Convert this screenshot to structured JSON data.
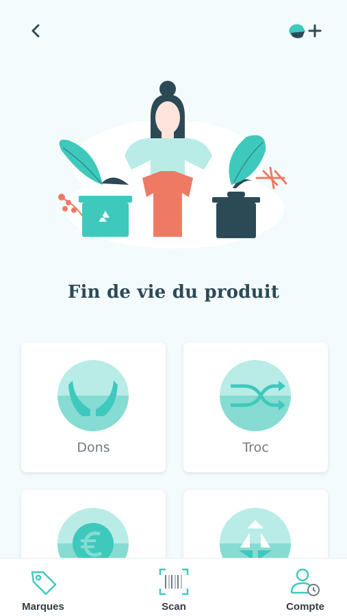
{
  "header": {
    "back_icon": "chevron-left-icon",
    "add_icon": "add-item-icon"
  },
  "page": {
    "title": "Fin de vie du produit"
  },
  "options": [
    {
      "label": "Dons",
      "icon": "hands-icon"
    },
    {
      "label": "Troc",
      "icon": "shuffle-icon"
    },
    {
      "label": "",
      "icon": "euro-icon"
    },
    {
      "label": "",
      "icon": "recycle-icon"
    }
  ],
  "bottom_nav": {
    "items": [
      {
        "label": "Marques",
        "icon": "tag-icon"
      },
      {
        "label": "Scan",
        "icon": "barcode-scan-icon"
      },
      {
        "label": "Compte",
        "icon": "user-clock-icon"
      }
    ]
  },
  "colors": {
    "background": "#f4fbfd",
    "accent_teal": "#3fc9bd",
    "accent_light": "#b9ece6",
    "coral": "#ef7a63",
    "dark_slate": "#2c4a55",
    "title_text": "#2c4a55",
    "card_label": "#6f7b80",
    "nav_label": "#333d42"
  }
}
